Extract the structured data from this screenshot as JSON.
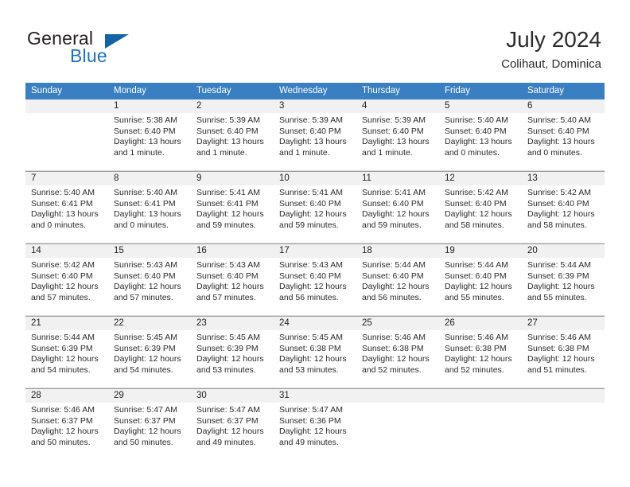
{
  "brand": {
    "word1": "General",
    "word2": "Blue",
    "logo_color": "#1464a5",
    "blue_text_color": "#1d72b8"
  },
  "header": {
    "title": "July 2024",
    "subtitle": "Colihaut, Dominica"
  },
  "theme": {
    "header_row_bg": "#3a7fc1",
    "day_number_band_bg": "#f1f1f1",
    "grid_line": "#9d9d9d"
  },
  "weekdays": [
    "Sunday",
    "Monday",
    "Tuesday",
    "Wednesday",
    "Thursday",
    "Friday",
    "Saturday"
  ],
  "weeks": [
    [
      {
        "day": "",
        "lines": []
      },
      {
        "day": "1",
        "lines": [
          "Sunrise: 5:38 AM",
          "Sunset: 6:40 PM",
          "Daylight: 13 hours",
          "and 1 minute."
        ]
      },
      {
        "day": "2",
        "lines": [
          "Sunrise: 5:39 AM",
          "Sunset: 6:40 PM",
          "Daylight: 13 hours",
          "and 1 minute."
        ]
      },
      {
        "day": "3",
        "lines": [
          "Sunrise: 5:39 AM",
          "Sunset: 6:40 PM",
          "Daylight: 13 hours",
          "and 1 minute."
        ]
      },
      {
        "day": "4",
        "lines": [
          "Sunrise: 5:39 AM",
          "Sunset: 6:40 PM",
          "Daylight: 13 hours",
          "and 1 minute."
        ]
      },
      {
        "day": "5",
        "lines": [
          "Sunrise: 5:40 AM",
          "Sunset: 6:40 PM",
          "Daylight: 13 hours",
          "and 0 minutes."
        ]
      },
      {
        "day": "6",
        "lines": [
          "Sunrise: 5:40 AM",
          "Sunset: 6:40 PM",
          "Daylight: 13 hours",
          "and 0 minutes."
        ]
      }
    ],
    [
      {
        "day": "7",
        "lines": [
          "Sunrise: 5:40 AM",
          "Sunset: 6:41 PM",
          "Daylight: 13 hours",
          "and 0 minutes."
        ]
      },
      {
        "day": "8",
        "lines": [
          "Sunrise: 5:40 AM",
          "Sunset: 6:41 PM",
          "Daylight: 13 hours",
          "and 0 minutes."
        ]
      },
      {
        "day": "9",
        "lines": [
          "Sunrise: 5:41 AM",
          "Sunset: 6:41 PM",
          "Daylight: 12 hours",
          "and 59 minutes."
        ]
      },
      {
        "day": "10",
        "lines": [
          "Sunrise: 5:41 AM",
          "Sunset: 6:40 PM",
          "Daylight: 12 hours",
          "and 59 minutes."
        ]
      },
      {
        "day": "11",
        "lines": [
          "Sunrise: 5:41 AM",
          "Sunset: 6:40 PM",
          "Daylight: 12 hours",
          "and 59 minutes."
        ]
      },
      {
        "day": "12",
        "lines": [
          "Sunrise: 5:42 AM",
          "Sunset: 6:40 PM",
          "Daylight: 12 hours",
          "and 58 minutes."
        ]
      },
      {
        "day": "13",
        "lines": [
          "Sunrise: 5:42 AM",
          "Sunset: 6:40 PM",
          "Daylight: 12 hours",
          "and 58 minutes."
        ]
      }
    ],
    [
      {
        "day": "14",
        "lines": [
          "Sunrise: 5:42 AM",
          "Sunset: 6:40 PM",
          "Daylight: 12 hours",
          "and 57 minutes."
        ]
      },
      {
        "day": "15",
        "lines": [
          "Sunrise: 5:43 AM",
          "Sunset: 6:40 PM",
          "Daylight: 12 hours",
          "and 57 minutes."
        ]
      },
      {
        "day": "16",
        "lines": [
          "Sunrise: 5:43 AM",
          "Sunset: 6:40 PM",
          "Daylight: 12 hours",
          "and 57 minutes."
        ]
      },
      {
        "day": "17",
        "lines": [
          "Sunrise: 5:43 AM",
          "Sunset: 6:40 PM",
          "Daylight: 12 hours",
          "and 56 minutes."
        ]
      },
      {
        "day": "18",
        "lines": [
          "Sunrise: 5:44 AM",
          "Sunset: 6:40 PM",
          "Daylight: 12 hours",
          "and 56 minutes."
        ]
      },
      {
        "day": "19",
        "lines": [
          "Sunrise: 5:44 AM",
          "Sunset: 6:40 PM",
          "Daylight: 12 hours",
          "and 55 minutes."
        ]
      },
      {
        "day": "20",
        "lines": [
          "Sunrise: 5:44 AM",
          "Sunset: 6:39 PM",
          "Daylight: 12 hours",
          "and 55 minutes."
        ]
      }
    ],
    [
      {
        "day": "21",
        "lines": [
          "Sunrise: 5:44 AM",
          "Sunset: 6:39 PM",
          "Daylight: 12 hours",
          "and 54 minutes."
        ]
      },
      {
        "day": "22",
        "lines": [
          "Sunrise: 5:45 AM",
          "Sunset: 6:39 PM",
          "Daylight: 12 hours",
          "and 54 minutes."
        ]
      },
      {
        "day": "23",
        "lines": [
          "Sunrise: 5:45 AM",
          "Sunset: 6:39 PM",
          "Daylight: 12 hours",
          "and 53 minutes."
        ]
      },
      {
        "day": "24",
        "lines": [
          "Sunrise: 5:45 AM",
          "Sunset: 6:38 PM",
          "Daylight: 12 hours",
          "and 53 minutes."
        ]
      },
      {
        "day": "25",
        "lines": [
          "Sunrise: 5:46 AM",
          "Sunset: 6:38 PM",
          "Daylight: 12 hours",
          "and 52 minutes."
        ]
      },
      {
        "day": "26",
        "lines": [
          "Sunrise: 5:46 AM",
          "Sunset: 6:38 PM",
          "Daylight: 12 hours",
          "and 52 minutes."
        ]
      },
      {
        "day": "27",
        "lines": [
          "Sunrise: 5:46 AM",
          "Sunset: 6:38 PM",
          "Daylight: 12 hours",
          "and 51 minutes."
        ]
      }
    ],
    [
      {
        "day": "28",
        "lines": [
          "Sunrise: 5:46 AM",
          "Sunset: 6:37 PM",
          "Daylight: 12 hours",
          "and 50 minutes."
        ]
      },
      {
        "day": "29",
        "lines": [
          "Sunrise: 5:47 AM",
          "Sunset: 6:37 PM",
          "Daylight: 12 hours",
          "and 50 minutes."
        ]
      },
      {
        "day": "30",
        "lines": [
          "Sunrise: 5:47 AM",
          "Sunset: 6:37 PM",
          "Daylight: 12 hours",
          "and 49 minutes."
        ]
      },
      {
        "day": "31",
        "lines": [
          "Sunrise: 5:47 AM",
          "Sunset: 6:36 PM",
          "Daylight: 12 hours",
          "and 49 minutes."
        ]
      },
      {
        "day": "",
        "lines": []
      },
      {
        "day": "",
        "lines": []
      },
      {
        "day": "",
        "lines": []
      }
    ]
  ]
}
